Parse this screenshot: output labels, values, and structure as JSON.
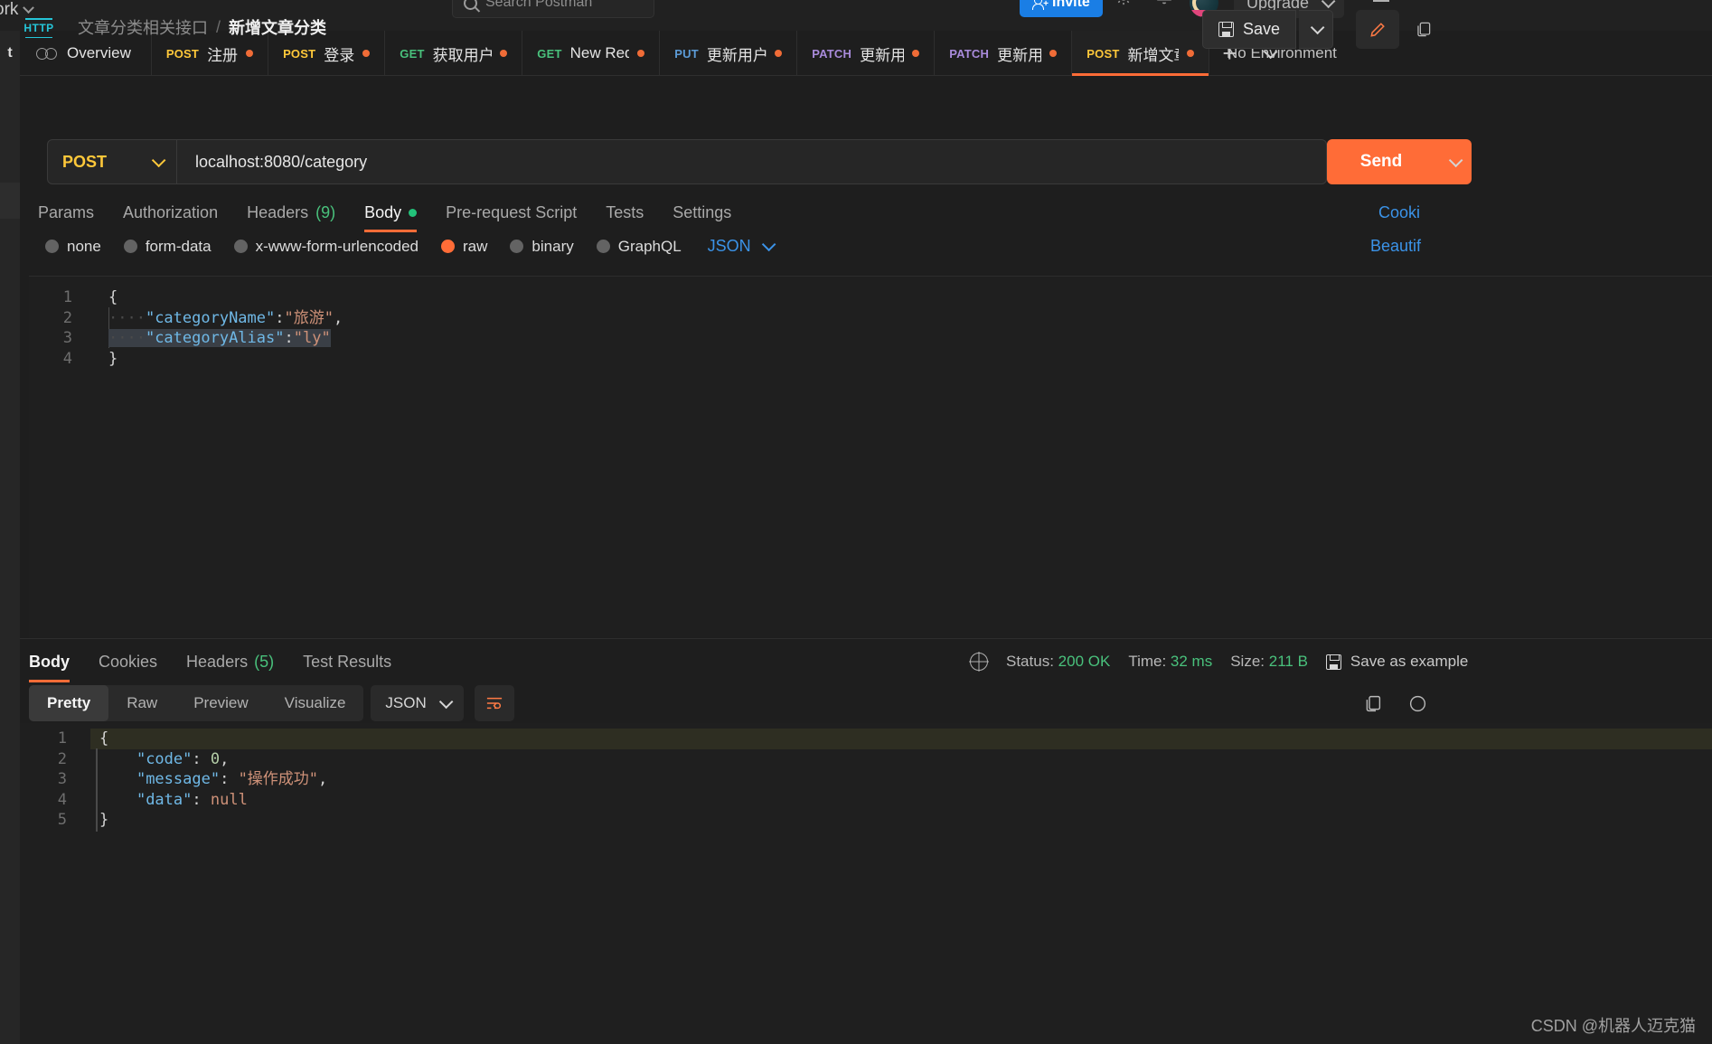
{
  "header": {
    "workspace": "ork",
    "search_placeholder": "Search Postman",
    "invite_label": "Invite",
    "upgrade_label": "Upgrade",
    "gear_icon": "gear-icon",
    "bell_icon": "bell-icon"
  },
  "tabstrip": {
    "rail_label": "t",
    "overview_label": "Overview",
    "no_environment": "No Environment",
    "plus_label": "+",
    "tabs": [
      {
        "method": "POST",
        "title": "注册",
        "dirty": true
      },
      {
        "method": "POST",
        "title": "登录",
        "dirty": true
      },
      {
        "method": "GET",
        "title": "获取用户详",
        "dirty": true
      },
      {
        "method": "GET",
        "title": "New Reque",
        "dirty": true
      },
      {
        "method": "PUT",
        "title": "更新用户基z",
        "dirty": true
      },
      {
        "method": "PATCH",
        "title": "更新用户氵",
        "dirty": true
      },
      {
        "method": "PATCH",
        "title": "更新用户氵",
        "dirty": true
      },
      {
        "method": "POST",
        "title": "新增文章分",
        "dirty": true
      }
    ]
  },
  "request": {
    "proto_badge": "HTTP",
    "breadcrumb_parent": "文章分类相关接口",
    "breadcrumb_sep": "/",
    "breadcrumb_current": "新增文章分类",
    "save_label": "Save",
    "method": "POST",
    "url": "localhost:8080/category",
    "send_label": "Send",
    "tabs": [
      {
        "label": "Params",
        "count": null,
        "active": false,
        "dot": false
      },
      {
        "label": "Authorization",
        "count": null,
        "active": false,
        "dot": false
      },
      {
        "label": "Headers",
        "count": "(9)",
        "active": false,
        "dot": false
      },
      {
        "label": "Body",
        "count": null,
        "active": true,
        "dot": true
      },
      {
        "label": "Pre-request Script",
        "count": null,
        "active": false,
        "dot": false
      },
      {
        "label": "Tests",
        "count": null,
        "active": false,
        "dot": false
      },
      {
        "label": "Settings",
        "count": null,
        "active": false,
        "dot": false
      }
    ],
    "cookies_link": "Cooki",
    "body_types": [
      {
        "label": "none",
        "selected": false
      },
      {
        "label": "form-data",
        "selected": false
      },
      {
        "label": "x-www-form-urlencoded",
        "selected": false
      },
      {
        "label": "raw",
        "selected": true
      },
      {
        "label": "binary",
        "selected": false
      },
      {
        "label": "GraphQL",
        "selected": false
      }
    ],
    "body_format": "JSON",
    "beautify_label": "Beautif",
    "body_lines": [
      "1",
      "2",
      "3",
      "4"
    ],
    "body_code": {
      "l1": "{",
      "l2_ws": "····",
      "l2_key": "\"categoryName\"",
      "l2_colon": ":",
      "l2_val": "\"旅游\"",
      "l2_comma": ",",
      "l3_ws": "····",
      "l3_key": "\"categoryAlias\"",
      "l3_colon": ":",
      "l3_val": "\"ly\"",
      "l4": "}"
    }
  },
  "response": {
    "tabs": [
      {
        "label": "Body",
        "count": null,
        "active": true
      },
      {
        "label": "Cookies",
        "count": null,
        "active": false
      },
      {
        "label": "Headers",
        "count": "(5)",
        "active": false
      },
      {
        "label": "Test Results",
        "count": null,
        "active": false
      }
    ],
    "status_label": "Status:",
    "status_value": "200 OK",
    "time_label": "Time:",
    "time_value": "32 ms",
    "size_label": "Size:",
    "size_value": "211 B",
    "save_example_label": "Save as example",
    "view_modes": [
      {
        "label": "Pretty",
        "active": true
      },
      {
        "label": "Raw",
        "active": false
      },
      {
        "label": "Preview",
        "active": false
      },
      {
        "label": "Visualize",
        "active": false
      }
    ],
    "format": "JSON",
    "lines": [
      "1",
      "2",
      "3",
      "4",
      "5"
    ],
    "code": {
      "l1": "{",
      "l2_key": "\"code\"",
      "l2_sep": ": ",
      "l2_val": "0",
      "l2_comma": ",",
      "l3_key": "\"message\"",
      "l3_sep": ": ",
      "l3_val": "\"操作成功\"",
      "l3_comma": ",",
      "l4_key": "\"data\"",
      "l4_sep": ": ",
      "l4_val": "null",
      "l5": "}"
    }
  },
  "watermark": "CSDN @机器人迈克猫",
  "colors": {
    "accent": "#ff6c37",
    "post": "#ffc83a",
    "get": "#49c17c",
    "put": "#5c9bd6",
    "patch": "#a98bdb",
    "link": "#3b93e8",
    "success": "#49c17c",
    "invite": "#1a7ee5"
  }
}
